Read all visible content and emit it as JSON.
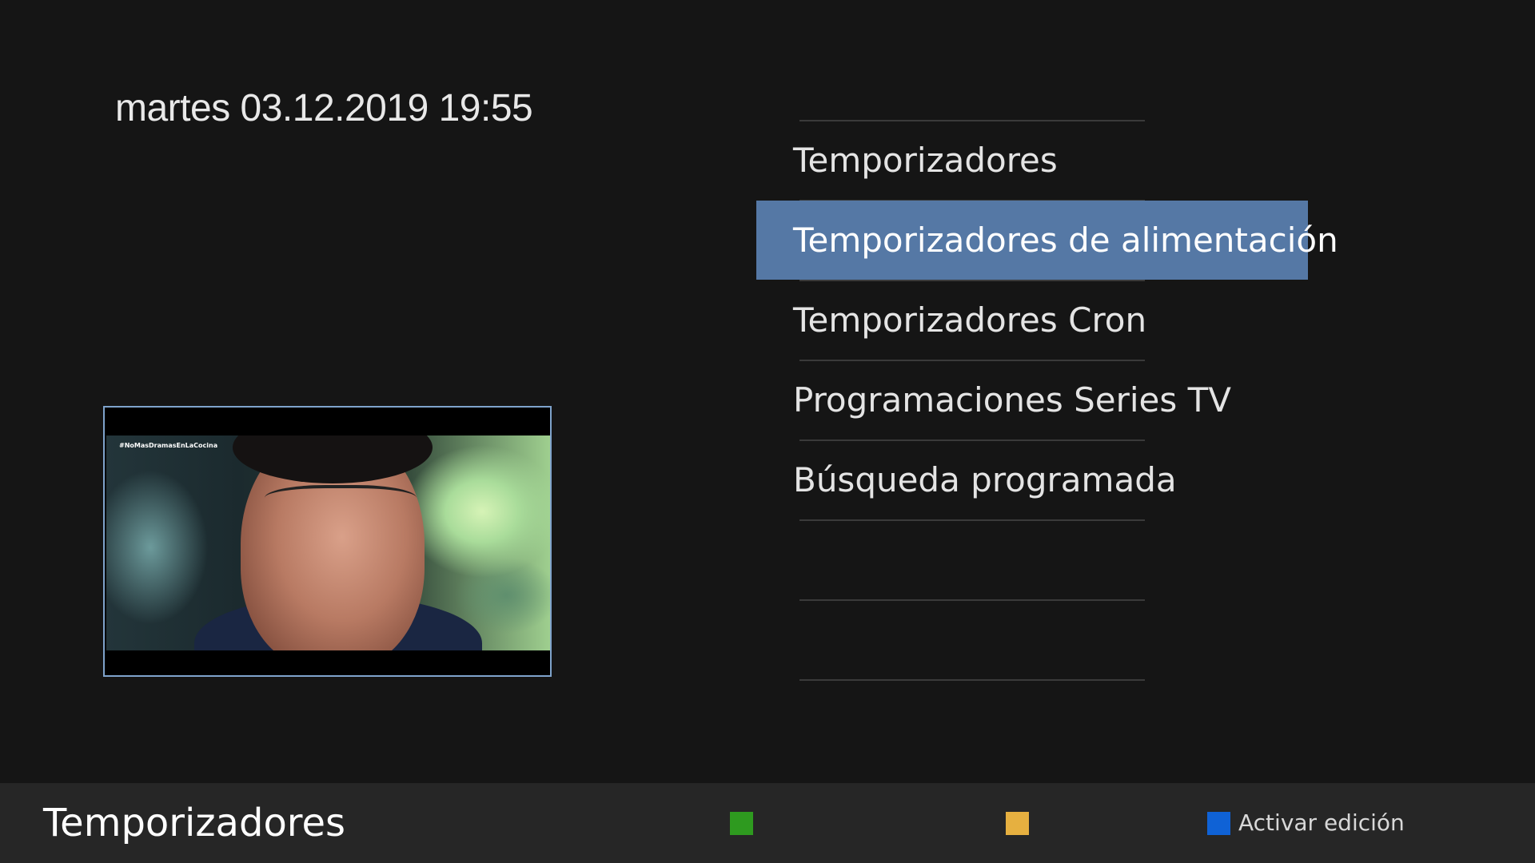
{
  "clock": "martes 03.12.2019 19:55",
  "preview": {
    "hashtag": "#NoMasDramasEnLaCocina"
  },
  "menu": {
    "items": [
      {
        "label": "Temporizadores"
      },
      {
        "label": "Temporizadores de alimentación"
      },
      {
        "label": "Temporizadores Cron"
      },
      {
        "label": "Programaciones Series TV"
      },
      {
        "label": "Búsqueda programada"
      }
    ],
    "selected_index": 1
  },
  "footer": {
    "title": "Temporizadores",
    "keys": {
      "green": {
        "color": "#2e9a1f",
        "label": ""
      },
      "yellow": {
        "color": "#e6b040",
        "label": ""
      },
      "blue": {
        "color": "#0f62d6",
        "label": "Activar edición"
      }
    }
  },
  "colors": {
    "background": "#151515",
    "selection": "#5578a5",
    "bottom_bar": "#262626",
    "pip_border": "#7fa3cc"
  }
}
